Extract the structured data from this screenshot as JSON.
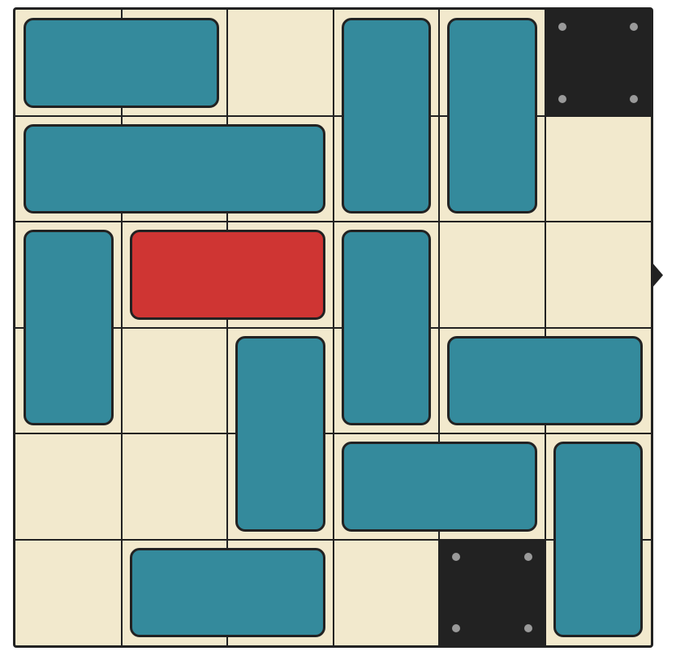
{
  "puzzle": {
    "grid_size": 6,
    "colors": {
      "board": "#f2e9cd",
      "line": "#222222",
      "block": "#348a9c",
      "target_block": "#cf3533",
      "wall": "#222222",
      "bolt": "#9a9a9a"
    },
    "exit": {
      "side": "right",
      "row": 2,
      "icon": "exit-arrow-icon"
    },
    "blocks": [
      {
        "id": "h-r0-c0",
        "row": 0,
        "col": 0,
        "len": 2,
        "dir": "h",
        "target": false
      },
      {
        "id": "v-r0-c3",
        "row": 0,
        "col": 3,
        "len": 2,
        "dir": "v",
        "target": false
      },
      {
        "id": "v-r0-c4",
        "row": 0,
        "col": 4,
        "len": 2,
        "dir": "v",
        "target": false
      },
      {
        "id": "h-r1-c0",
        "row": 1,
        "col": 0,
        "len": 3,
        "dir": "h",
        "target": false
      },
      {
        "id": "v-r2-c0",
        "row": 2,
        "col": 0,
        "len": 2,
        "dir": "v",
        "target": false
      },
      {
        "id": "target-r2-c1",
        "row": 2,
        "col": 1,
        "len": 2,
        "dir": "h",
        "target": true
      },
      {
        "id": "v-r2-c3",
        "row": 2,
        "col": 3,
        "len": 2,
        "dir": "v",
        "target": false
      },
      {
        "id": "v-r3-c2",
        "row": 3,
        "col": 2,
        "len": 2,
        "dir": "v",
        "target": false
      },
      {
        "id": "h-r3-c4",
        "row": 3,
        "col": 4,
        "len": 2,
        "dir": "h",
        "target": false
      },
      {
        "id": "h-r4-c3",
        "row": 4,
        "col": 3,
        "len": 2,
        "dir": "h",
        "target": false
      },
      {
        "id": "v-r4-c5",
        "row": 4,
        "col": 5,
        "len": 2,
        "dir": "v",
        "target": false
      },
      {
        "id": "h-r5-c1",
        "row": 5,
        "col": 1,
        "len": 2,
        "dir": "h",
        "target": false
      }
    ],
    "walls": [
      {
        "id": "wall-r0-c5",
        "row": 0,
        "col": 5
      },
      {
        "id": "wall-r5-c4",
        "row": 5,
        "col": 4
      }
    ]
  }
}
